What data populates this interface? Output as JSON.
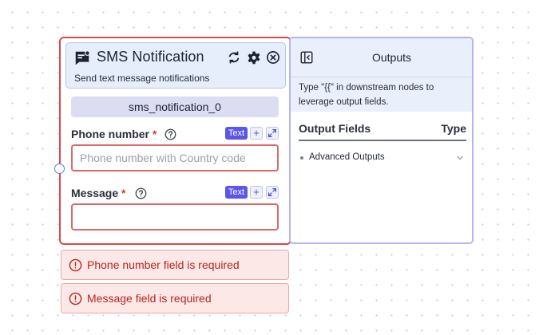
{
  "node": {
    "title": "SMS Notification",
    "description": "Send text message notifications",
    "id_label": "sms_notification_0",
    "fields": [
      {
        "label": "Phone number",
        "required_mark": "*",
        "badge": "Text",
        "placeholder": "Phone number with Country code",
        "value": ""
      },
      {
        "label": "Message",
        "required_mark": "*",
        "badge": "Text",
        "placeholder": "",
        "value": ""
      }
    ],
    "header_icons": [
      "message-icon",
      "refresh-icon",
      "gear-icon",
      "close-icon"
    ],
    "field_icons": [
      "help-icon",
      "plus-icon",
      "expand-icon"
    ]
  },
  "outputs": {
    "title": "Outputs",
    "note": "Type \"{{\" in downstream nodes to leverage output fields.",
    "columns": {
      "name": "Output Fields",
      "type": "Type"
    },
    "items": [
      {
        "label": "Advanced Outputs"
      }
    ],
    "icons": [
      "collapse-panel-icon",
      "chevron-down-icon"
    ]
  },
  "errors": [
    {
      "message": "Phone number field is required"
    },
    {
      "message": "Message field is required"
    }
  ],
  "colors": {
    "error_border": "#d84a4a",
    "error_bg": "#fde8e8",
    "error_text": "#b3261e",
    "badge_bg": "#5b55e8",
    "node_header_bg": "#e6eefb",
    "outputs_border": "#b6b4ee",
    "id_pill_bg": "#dcdcf3"
  }
}
